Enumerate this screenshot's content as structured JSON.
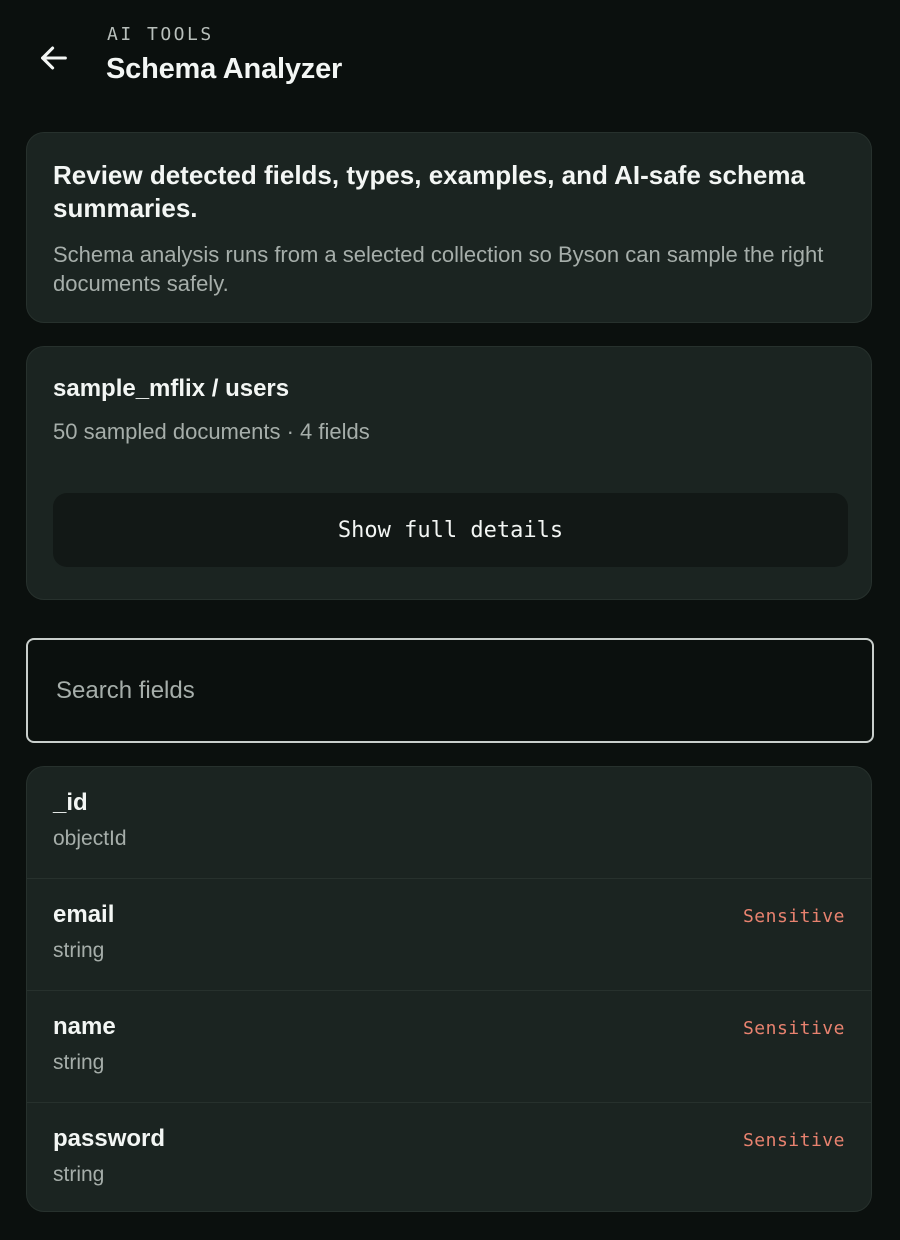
{
  "header": {
    "eyebrow": "AI TOOLS",
    "title": "Schema Analyzer",
    "back_icon": "arrow-left-icon"
  },
  "intro": {
    "headline": "Review detected fields, types, examples, and AI-safe schema summaries.",
    "body": "Schema analysis runs from a selected collection so Byson can sample the right documents safely."
  },
  "collection": {
    "name": "sample_mflix / users",
    "meta": "50 sampled documents · 4 fields",
    "details_button_label": "Show full details"
  },
  "search": {
    "placeholder": "Search fields",
    "value": ""
  },
  "fields": [
    {
      "name": "_id",
      "type": "objectId",
      "badge": ""
    },
    {
      "name": "email",
      "type": "string",
      "badge": "Sensitive"
    },
    {
      "name": "name",
      "type": "string",
      "badge": "Sensitive"
    },
    {
      "name": "password",
      "type": "string",
      "badge": "Sensitive"
    }
  ],
  "colors": {
    "background": "#0b100e",
    "card": "#1b2421",
    "sensitive": "#e8826f",
    "text_primary": "#f3f6f4",
    "text_secondary": "#a6aeaa"
  }
}
